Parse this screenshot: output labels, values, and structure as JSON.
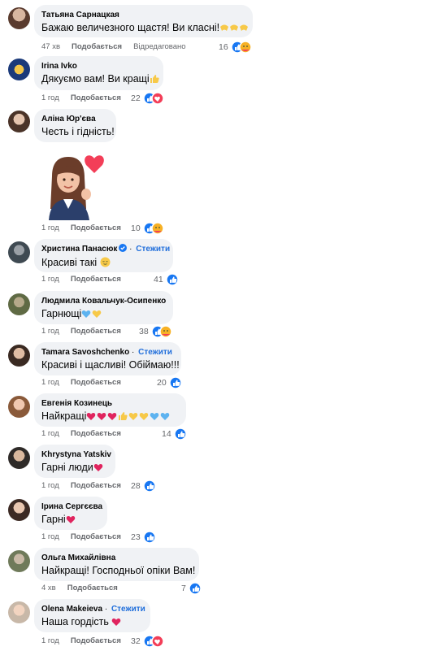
{
  "comments": [
    {
      "author": "Татьяна Сарнацкая",
      "text": "Бажаю величезного щастя! Ви класні!",
      "time": "47 хв",
      "like": "Подобається",
      "reply": "Відредаговано",
      "count": "16"
    },
    {
      "author": "Irina Ivko",
      "text": "Дякуємо вам! Ви кращі",
      "time": "1 год",
      "like": "Подобається",
      "count": "22"
    },
    {
      "author": "Аліна Юр'єва",
      "text": "Честь і гідність!",
      "time": "1 год",
      "like": "Подобається",
      "count": "10"
    },
    {
      "author": "Христина Панасюк",
      "follow": "Стежити",
      "text": "Красиві такі",
      "time": "1 год",
      "like": "Подобається",
      "count": "41"
    },
    {
      "author": "Людмила Ковальчук-Осипенко",
      "text": "Гарнющі",
      "time": "1 год",
      "like": "Подобається",
      "count": "38"
    },
    {
      "author": "Tamara Savoshchenko",
      "follow": "Стежити",
      "text": "Красиві і щасливі! Обіймаю!!!",
      "time": "1 год",
      "like": "Подобається",
      "count": "20"
    },
    {
      "author": "Евгенія Козинець",
      "text": "Найкращі",
      "time": "1 год",
      "like": "Подобається",
      "count": "14"
    },
    {
      "author": "Khrystyna Yatskiv",
      "text": "Гарні люди",
      "time": "1 год",
      "like": "Подобається",
      "count": "28"
    },
    {
      "author": "Ірина Сергєєва",
      "text": "Гарні",
      "time": "1 год",
      "like": "Подобається",
      "count": "23"
    },
    {
      "author": "Ольга Михайлівна",
      "text": "Найкращі! Господньої опіки Вам!",
      "time": "4 хв",
      "like": "Подобається",
      "count": "7"
    },
    {
      "author": "Olena Makeieva",
      "follow": "Стежити",
      "text": "Наша гордість",
      "time": "1 год",
      "like": "Подобається",
      "count": "32"
    }
  ],
  "colors": {
    "like_blue": "#1877f2",
    "love_red": "#f33e58",
    "follow_blue": "#216fdb"
  },
  "icons": {
    "like": "thumbs-up-icon",
    "love": "heart-icon",
    "care": "hug-face-icon",
    "verified": "verified-badge-icon"
  }
}
